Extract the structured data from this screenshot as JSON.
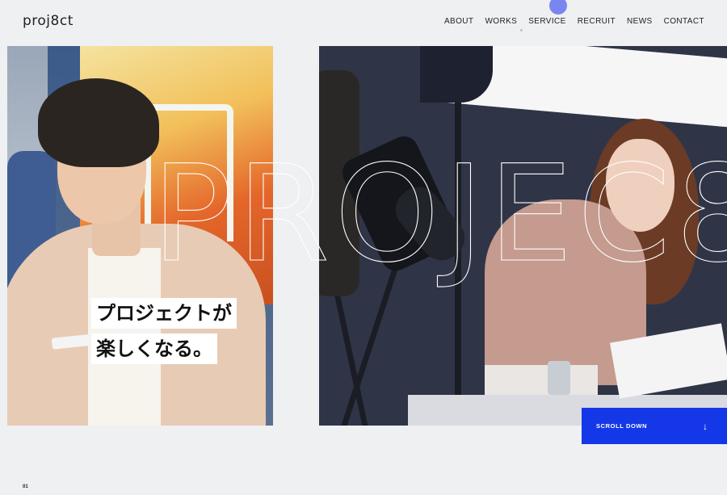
{
  "header": {
    "logo": "proj8ct",
    "nav": [
      "ABOUT",
      "WORKS",
      "SERVICE",
      "RECRUIT",
      "NEWS",
      "CONTACT"
    ]
  },
  "hero": {
    "catch_line1": "プロジェクトが",
    "catch_line2": "楽しくなる。",
    "outline_word": "PROJEC8"
  },
  "scroll": {
    "label": "SCROLL DOWN",
    "arrow": "↓"
  },
  "pager": {
    "current": "01"
  },
  "colors": {
    "background": "#eff0f2",
    "accent_blue": "#1438e8",
    "nav_dot": "#7a86f0"
  }
}
